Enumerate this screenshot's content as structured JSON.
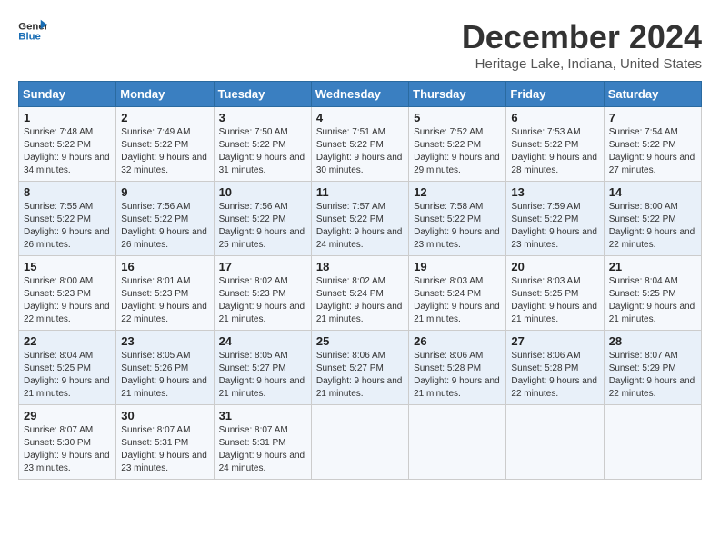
{
  "logo": {
    "line1": "General",
    "line2": "Blue"
  },
  "title": "December 2024",
  "subtitle": "Heritage Lake, Indiana, United States",
  "days_of_week": [
    "Sunday",
    "Monday",
    "Tuesday",
    "Wednesday",
    "Thursday",
    "Friday",
    "Saturday"
  ],
  "weeks": [
    [
      {
        "day": "1",
        "sunrise": "7:48 AM",
        "sunset": "5:22 PM",
        "daylight": "9 hours and 34 minutes."
      },
      {
        "day": "2",
        "sunrise": "7:49 AM",
        "sunset": "5:22 PM",
        "daylight": "9 hours and 32 minutes."
      },
      {
        "day": "3",
        "sunrise": "7:50 AM",
        "sunset": "5:22 PM",
        "daylight": "9 hours and 31 minutes."
      },
      {
        "day": "4",
        "sunrise": "7:51 AM",
        "sunset": "5:22 PM",
        "daylight": "9 hours and 30 minutes."
      },
      {
        "day": "5",
        "sunrise": "7:52 AM",
        "sunset": "5:22 PM",
        "daylight": "9 hours and 29 minutes."
      },
      {
        "day": "6",
        "sunrise": "7:53 AM",
        "sunset": "5:22 PM",
        "daylight": "9 hours and 28 minutes."
      },
      {
        "day": "7",
        "sunrise": "7:54 AM",
        "sunset": "5:22 PM",
        "daylight": "9 hours and 27 minutes."
      }
    ],
    [
      {
        "day": "8",
        "sunrise": "7:55 AM",
        "sunset": "5:22 PM",
        "daylight": "9 hours and 26 minutes."
      },
      {
        "day": "9",
        "sunrise": "7:56 AM",
        "sunset": "5:22 PM",
        "daylight": "9 hours and 26 minutes."
      },
      {
        "day": "10",
        "sunrise": "7:56 AM",
        "sunset": "5:22 PM",
        "daylight": "9 hours and 25 minutes."
      },
      {
        "day": "11",
        "sunrise": "7:57 AM",
        "sunset": "5:22 PM",
        "daylight": "9 hours and 24 minutes."
      },
      {
        "day": "12",
        "sunrise": "7:58 AM",
        "sunset": "5:22 PM",
        "daylight": "9 hours and 23 minutes."
      },
      {
        "day": "13",
        "sunrise": "7:59 AM",
        "sunset": "5:22 PM",
        "daylight": "9 hours and 23 minutes."
      },
      {
        "day": "14",
        "sunrise": "8:00 AM",
        "sunset": "5:22 PM",
        "daylight": "9 hours and 22 minutes."
      }
    ],
    [
      {
        "day": "15",
        "sunrise": "8:00 AM",
        "sunset": "5:23 PM",
        "daylight": "9 hours and 22 minutes."
      },
      {
        "day": "16",
        "sunrise": "8:01 AM",
        "sunset": "5:23 PM",
        "daylight": "9 hours and 22 minutes."
      },
      {
        "day": "17",
        "sunrise": "8:02 AM",
        "sunset": "5:23 PM",
        "daylight": "9 hours and 21 minutes."
      },
      {
        "day": "18",
        "sunrise": "8:02 AM",
        "sunset": "5:24 PM",
        "daylight": "9 hours and 21 minutes."
      },
      {
        "day": "19",
        "sunrise": "8:03 AM",
        "sunset": "5:24 PM",
        "daylight": "9 hours and 21 minutes."
      },
      {
        "day": "20",
        "sunrise": "8:03 AM",
        "sunset": "5:25 PM",
        "daylight": "9 hours and 21 minutes."
      },
      {
        "day": "21",
        "sunrise": "8:04 AM",
        "sunset": "5:25 PM",
        "daylight": "9 hours and 21 minutes."
      }
    ],
    [
      {
        "day": "22",
        "sunrise": "8:04 AM",
        "sunset": "5:25 PM",
        "daylight": "9 hours and 21 minutes."
      },
      {
        "day": "23",
        "sunrise": "8:05 AM",
        "sunset": "5:26 PM",
        "daylight": "9 hours and 21 minutes."
      },
      {
        "day": "24",
        "sunrise": "8:05 AM",
        "sunset": "5:27 PM",
        "daylight": "9 hours and 21 minutes."
      },
      {
        "day": "25",
        "sunrise": "8:06 AM",
        "sunset": "5:27 PM",
        "daylight": "9 hours and 21 minutes."
      },
      {
        "day": "26",
        "sunrise": "8:06 AM",
        "sunset": "5:28 PM",
        "daylight": "9 hours and 21 minutes."
      },
      {
        "day": "27",
        "sunrise": "8:06 AM",
        "sunset": "5:28 PM",
        "daylight": "9 hours and 22 minutes."
      },
      {
        "day": "28",
        "sunrise": "8:07 AM",
        "sunset": "5:29 PM",
        "daylight": "9 hours and 22 minutes."
      }
    ],
    [
      {
        "day": "29",
        "sunrise": "8:07 AM",
        "sunset": "5:30 PM",
        "daylight": "9 hours and 23 minutes."
      },
      {
        "day": "30",
        "sunrise": "8:07 AM",
        "sunset": "5:31 PM",
        "daylight": "9 hours and 23 minutes."
      },
      {
        "day": "31",
        "sunrise": "8:07 AM",
        "sunset": "5:31 PM",
        "daylight": "9 hours and 24 minutes."
      },
      null,
      null,
      null,
      null
    ]
  ],
  "labels": {
    "sunrise": "Sunrise:",
    "sunset": "Sunset:",
    "daylight": "Daylight:"
  }
}
